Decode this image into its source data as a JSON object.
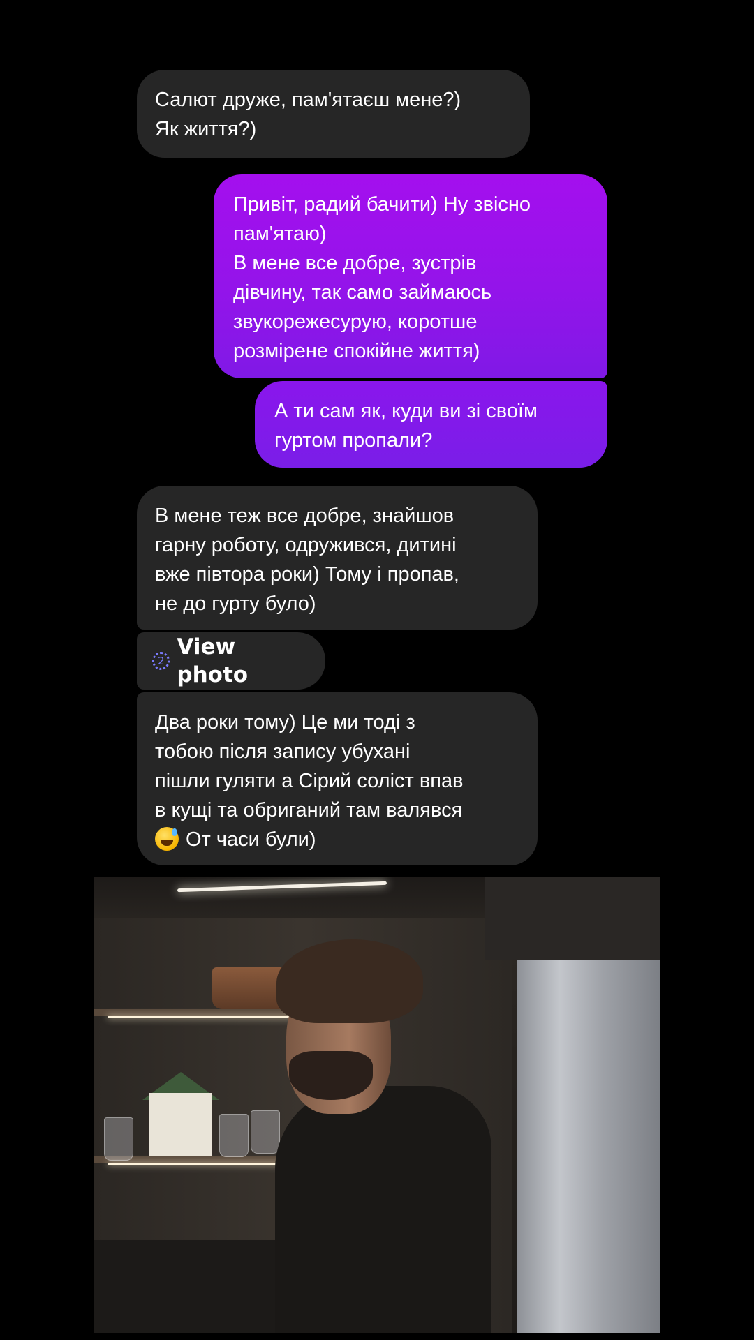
{
  "messages": [
    {
      "direction": "incoming",
      "text": "Салют друже, пам'ятаєш мене?)\nЯк життя?)"
    },
    {
      "direction": "outgoing",
      "text": "Привіт, радий бачити) Ну звісно\nпам'ятаю)\nВ мене все добре, зустрів\nдівчину, так само займаюсь\nзвукорежесурую, коротше\nрозмірене спокійне життя)"
    },
    {
      "direction": "outgoing",
      "text": "А ти сам як, куди ви зі своїм\nгуртом пропали?"
    },
    {
      "direction": "incoming",
      "text": "В мене теж все добре, знайшов\nгарну роботу, одружився, дитині\nвже півтора роки) Тому і пропав,\nне до гурту було)"
    },
    {
      "direction": "incoming",
      "type": "view-once-photo",
      "label": "View photo",
      "icon": "view-once-icon",
      "icon_text": "2"
    },
    {
      "direction": "incoming",
      "text": "Два роки тому) Це ми тоді з\nтобою після запису убухані\nпішли гуляти а Сірий соліст впав\nв кущі та обриганий там валявся",
      "emoji": "grinning-face-with-sweat-icon",
      "text_after_emoji": "От часи були)"
    }
  ],
  "colors": {
    "background": "#000000",
    "incoming_bubble": "#262626",
    "outgoing_bubble_top": "#a40fee",
    "outgoing_bubble_bottom": "#7a1ee8",
    "view_once_icon": "#7b7bff"
  }
}
